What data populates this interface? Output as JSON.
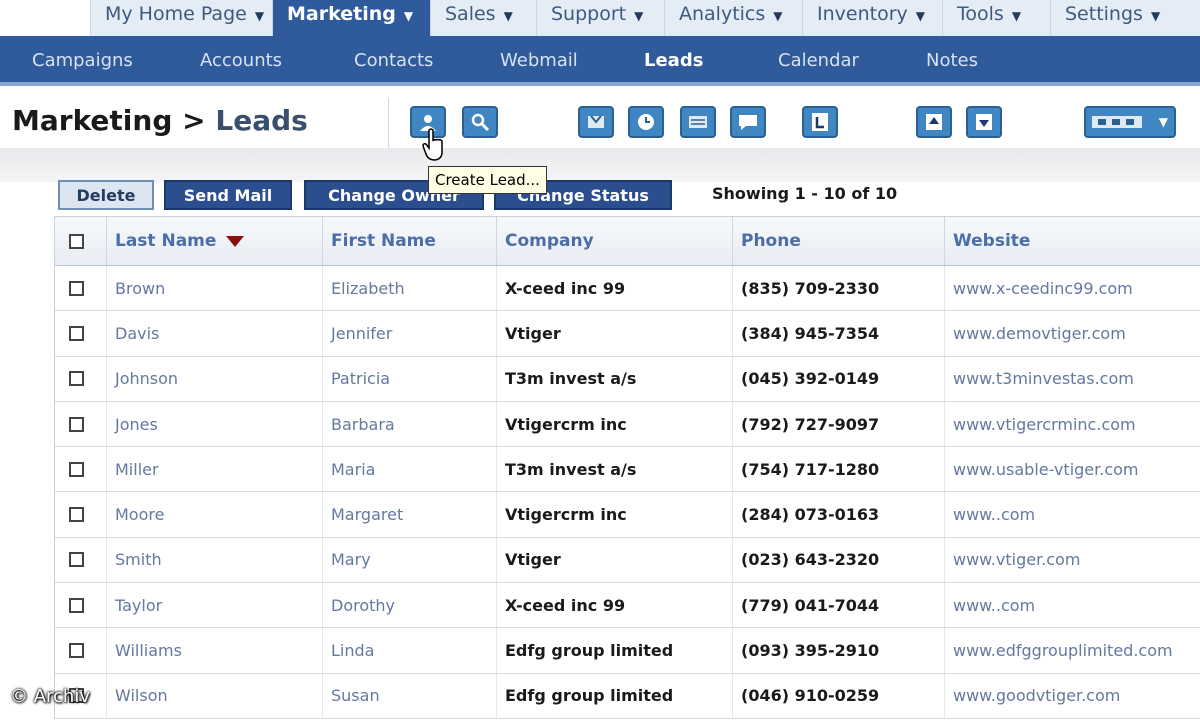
{
  "top_tabs": [
    {
      "label": "My Home Page"
    },
    {
      "label": "Marketing",
      "active": true
    },
    {
      "label": "Sales"
    },
    {
      "label": "Support"
    },
    {
      "label": "Analytics"
    },
    {
      "label": "Inventory"
    },
    {
      "label": "Tools"
    },
    {
      "label": "Settings"
    }
  ],
  "sub_tabs": [
    {
      "label": "Campaigns"
    },
    {
      "label": "Accounts"
    },
    {
      "label": "Contacts"
    },
    {
      "label": "Webmail"
    },
    {
      "label": "Leads",
      "active": true
    },
    {
      "label": "Calendar"
    },
    {
      "label": "Notes"
    }
  ],
  "breadcrumb": {
    "module": "Marketing",
    "separator": ">",
    "page": "Leads"
  },
  "toolbar": {
    "icons": [
      "create-lead-icon",
      "search-icon",
      "import-icon",
      "clock-icon",
      "export-icon",
      "chat-icon",
      "letter-l-icon",
      "upload-icon",
      "download-icon",
      "view-select-icon"
    ],
    "tooltip": "Create Lead..."
  },
  "actions": {
    "delete": "Delete",
    "send_mail": "Send Mail",
    "change_owner": "Change Owner",
    "change_status": "Change Status",
    "showing": "Showing 1 - 10 of 10"
  },
  "table": {
    "columns": {
      "last_name": "Last Name",
      "first_name": "First Name",
      "company": "Company",
      "phone": "Phone",
      "website": "Website"
    },
    "rows": [
      {
        "last": "Brown",
        "first": "Elizabeth",
        "company": "X-ceed inc 99",
        "phone": "(835) 709-2330",
        "web": "www.x-ceedinc99.com"
      },
      {
        "last": "Davis",
        "first": "Jennifer",
        "company": "Vtiger",
        "phone": "(384) 945-7354",
        "web": "www.demovtiger.com"
      },
      {
        "last": "Johnson",
        "first": "Patricia",
        "company": "T3m invest a/s",
        "phone": "(045) 392-0149",
        "web": "www.t3minvestas.com"
      },
      {
        "last": "Jones",
        "first": "Barbara",
        "company": "Vtigercrm inc",
        "phone": "(792) 727-9097",
        "web": "www.vtigercrminc.com"
      },
      {
        "last": "Miller",
        "first": "Maria",
        "company": "T3m invest a/s",
        "phone": "(754) 717-1280",
        "web": "www.usable-vtiger.com"
      },
      {
        "last": "Moore",
        "first": "Margaret",
        "company": "Vtigercrm inc",
        "phone": "(284) 073-0163",
        "web": "www..com"
      },
      {
        "last": "Smith",
        "first": "Mary",
        "company": "Vtiger",
        "phone": "(023) 643-2320",
        "web": "www.vtiger.com"
      },
      {
        "last": "Taylor",
        "first": "Dorothy",
        "company": "X-ceed inc 99",
        "phone": "(779) 041-7044",
        "web": "www..com"
      },
      {
        "last": "Williams",
        "first": "Linda",
        "company": "Edfg group limited",
        "phone": "(093) 395-2910",
        "web": "www.edfggrouplimited.com"
      },
      {
        "last": "Wilson",
        "first": "Susan",
        "company": "Edfg group limited",
        "phone": "(046) 910-0259",
        "web": "www.goodvtiger.com"
      }
    ]
  },
  "watermark": "© Archiv",
  "colors": {
    "nav_blue": "#2f5a9c",
    "tab_bg": "#e4edf6",
    "icon_blue": "#3f86c2",
    "sort_arrow": "#8a1010"
  }
}
